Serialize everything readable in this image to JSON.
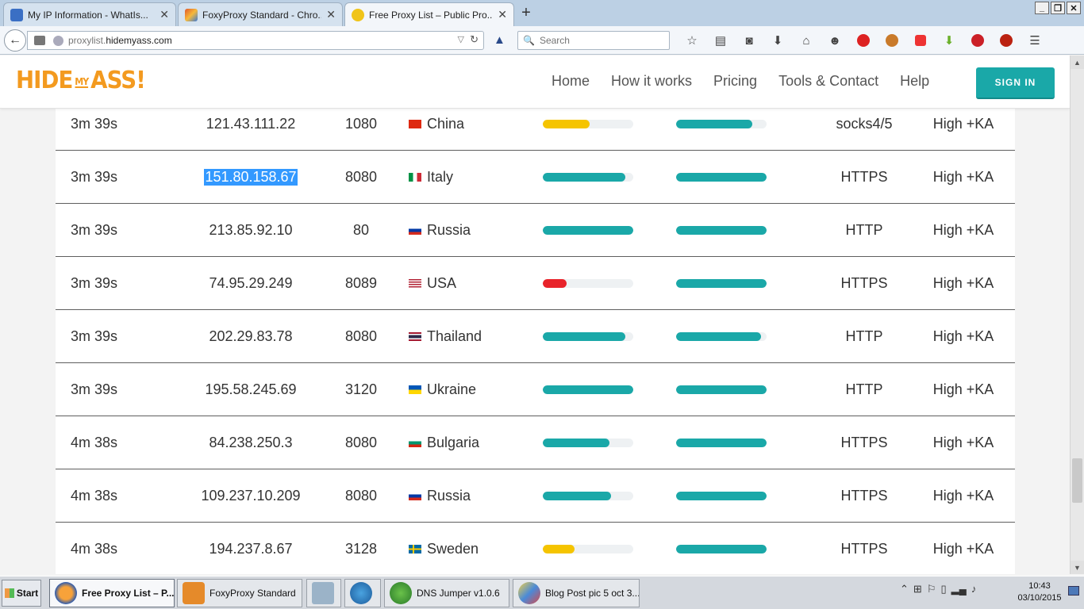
{
  "browser": {
    "tabs": [
      {
        "label": "My IP Information - WhatIs...",
        "icon": "whatismyip-favicon",
        "color": "#3a6fc4",
        "active": false
      },
      {
        "label": "FoxyProxy Standard - Chro...",
        "icon": "foxyproxy-favicon",
        "color": "#e0572a",
        "active": false
      },
      {
        "label": "Free Proxy List – Public Pro...",
        "icon": "hidemyass-favicon",
        "color": "#f0c419",
        "active": true
      }
    ],
    "new_tab": "+",
    "url_domain": "proxylist.",
    "url_host": "hidemyass.com",
    "search_placeholder": "Search",
    "toolbar_icons": [
      "star-icon",
      "reading-list-icon",
      "pocket-icon",
      "download-icon",
      "home-icon",
      "chat-icon",
      "adblock-icon",
      "greasemonkey-icon",
      "tracker-block-icon",
      "arrow-down-icon",
      "pinterest-icon",
      "mcafee-icon",
      "menu-icon"
    ]
  },
  "site": {
    "logo_hide": "HIDE",
    "logo_my": "MY",
    "logo_ass": "ASS!",
    "nav": [
      "Home",
      "How it works",
      "Pricing",
      "Tools & Contact",
      "Help"
    ],
    "signin_label": "SIGN IN",
    "colors": {
      "brand": "#f39a1f",
      "accent": "#1aa8a8",
      "warn": "#f5c400",
      "bad": "#e8232a"
    }
  },
  "proxies": [
    {
      "time": "3m 39s",
      "ip": "121.43.111.22",
      "port": "1080",
      "country": "China",
      "flag": "cn",
      "speed": 0.52,
      "speed_color": "#f5c400",
      "conn": 0.84,
      "type": "socks4/5",
      "anonymity": "High +KA"
    },
    {
      "time": "3m 39s",
      "ip": "151.80.158.67",
      "port": "8080",
      "country": "Italy",
      "flag": "it",
      "speed": 0.91,
      "speed_color": "#1aa8a8",
      "conn": 1.0,
      "type": "HTTPS",
      "anonymity": "High +KA",
      "selected": true
    },
    {
      "time": "3m 39s",
      "ip": "213.85.92.10",
      "port": "80",
      "country": "Russia",
      "flag": "ru",
      "speed": 1.0,
      "speed_color": "#1aa8a8",
      "conn": 1.0,
      "type": "HTTP",
      "anonymity": "High +KA"
    },
    {
      "time": "3m 39s",
      "ip": "74.95.29.249",
      "port": "8089",
      "country": "USA",
      "flag": "us",
      "speed": 0.26,
      "speed_color": "#e8232a",
      "conn": 1.0,
      "type": "HTTPS",
      "anonymity": "High +KA"
    },
    {
      "time": "3m 39s",
      "ip": "202.29.83.78",
      "port": "8080",
      "country": "Thailand",
      "flag": "th",
      "speed": 0.91,
      "speed_color": "#1aa8a8",
      "conn": 0.94,
      "type": "HTTP",
      "anonymity": "High +KA"
    },
    {
      "time": "3m 39s",
      "ip": "195.58.245.69",
      "port": "3120",
      "country": "Ukraine",
      "flag": "ua",
      "speed": 1.0,
      "speed_color": "#1aa8a8",
      "conn": 1.0,
      "type": "HTTP",
      "anonymity": "High +KA"
    },
    {
      "time": "4m 38s",
      "ip": "84.238.250.3",
      "port": "8080",
      "country": "Bulgaria",
      "flag": "bg",
      "speed": 0.74,
      "speed_color": "#1aa8a8",
      "conn": 1.0,
      "type": "HTTPS",
      "anonymity": "High +KA"
    },
    {
      "time": "4m 38s",
      "ip": "109.237.10.209",
      "port": "8080",
      "country": "Russia",
      "flag": "ru",
      "speed": 0.75,
      "speed_color": "#1aa8a8",
      "conn": 1.0,
      "type": "HTTPS",
      "anonymity": "High +KA"
    },
    {
      "time": "4m 38s",
      "ip": "194.237.8.67",
      "port": "3128",
      "country": "Sweden",
      "flag": "se",
      "speed": 0.35,
      "speed_color": "#f5c400",
      "conn": 1.0,
      "type": "HTTPS",
      "anonymity": "High +KA"
    }
  ],
  "taskbar": {
    "start": "Start",
    "items": [
      {
        "label": "Free Proxy List – P...",
        "icon": "firefox-icon",
        "active": true
      },
      {
        "label": "FoxyProxy Standard",
        "icon": "foxyproxy-icon",
        "active": false
      },
      {
        "label": "",
        "icon": "calculator-icon",
        "active": false
      },
      {
        "label": "",
        "icon": "network-icon",
        "active": false
      },
      {
        "label": "DNS Jumper v1.0.6",
        "icon": "dns-jumper-icon",
        "active": false
      },
      {
        "label": "Blog Post pic 5 oct 3...",
        "icon": "paint-icon",
        "active": false
      }
    ],
    "time": "10:43",
    "date": "03/10/2015"
  }
}
